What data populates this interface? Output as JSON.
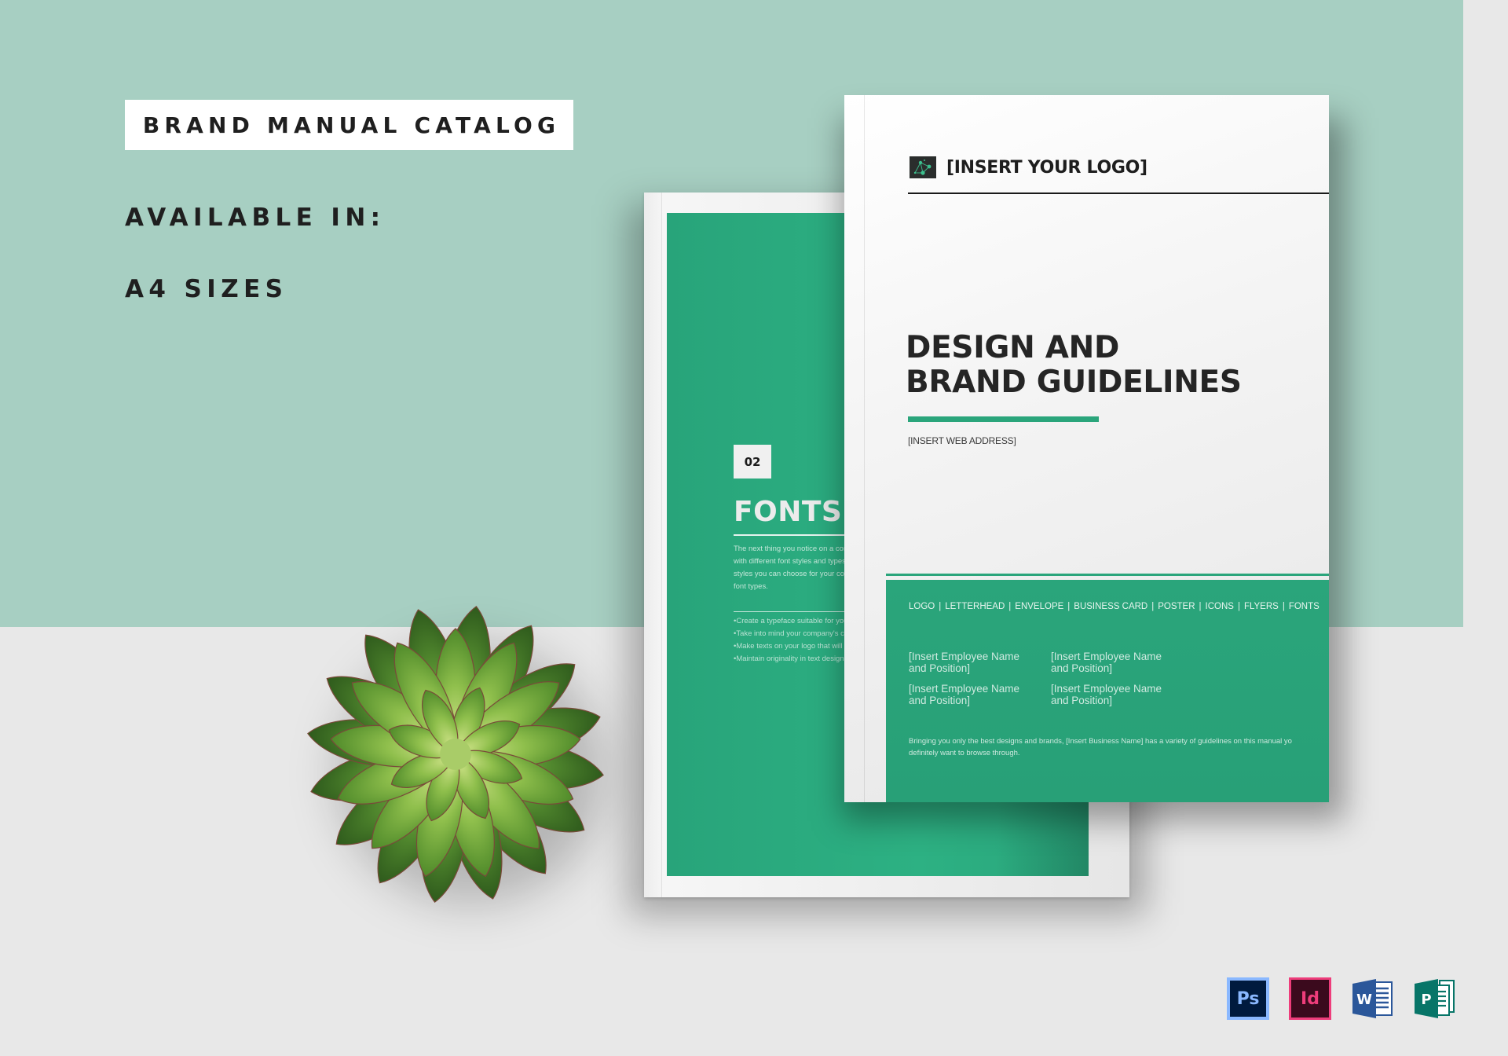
{
  "headline": {
    "title": "BRAND MANUAL CATALOG",
    "available_label": "AVAILABLE IN:",
    "sizes_label": "A4 SIZES"
  },
  "colors": {
    "background_teal": "#a7cfc2",
    "background_gray": "#e8e8e8",
    "brand_green": "#2aa57b",
    "text_dark": "#1f1f1f"
  },
  "back_page": {
    "section_number": "02",
    "section_title": "FONTS AN",
    "body_lines": [
      "The next thing you notice on a corporate l",
      "with different font styles and types to add",
      "styles you can choose for your corporate l",
      "font types."
    ],
    "bullets": [
      "Create a typeface suitable for your compa",
      "Take into mind your company's core com",
      "Make texts on your logo that will last a lif",
      "Maintain originality in text design and sty"
    ]
  },
  "front_cover": {
    "logo_icon": "network-logo-icon",
    "logo_text": "[INSERT YOUR LOGO]",
    "title_line1": "DESIGN AND",
    "title_line2": "BRAND GUIDELINES",
    "web_address": "[INSERT WEB ADDRESS]",
    "nav_items": [
      "LOGO",
      "LETTERHEAD",
      "ENVELOPE",
      "BUSINESS CARD",
      "POSTER",
      "ICONS",
      "FLYERS",
      "FONTS"
    ],
    "nav_separator": "|",
    "employees": [
      [
        "[Insert Employee Name",
        "and Position]"
      ],
      [
        "[Insert Employee Name",
        "and Position]"
      ],
      [
        "[Insert Employee Name",
        "and Position]"
      ],
      [
        "[Insert Employee Name",
        "and Position]"
      ]
    ],
    "blurb_line1": "Bringing you only the best designs and brands, [Insert Business Name] has a variety of guidelines on this manual yo",
    "blurb_line2": "definitely want to browse through."
  },
  "software_icons": [
    {
      "name": "photoshop-icon",
      "label": "Ps",
      "color": "#8ab8ff",
      "bg": "#001a3e"
    },
    {
      "name": "indesign-icon",
      "label": "Id",
      "color": "#ee3d7b",
      "bg": "#3b0a1d"
    },
    {
      "name": "word-icon",
      "label": "W",
      "color": "#2b579a"
    },
    {
      "name": "publisher-icon",
      "label": "P",
      "color": "#077568"
    }
  ]
}
